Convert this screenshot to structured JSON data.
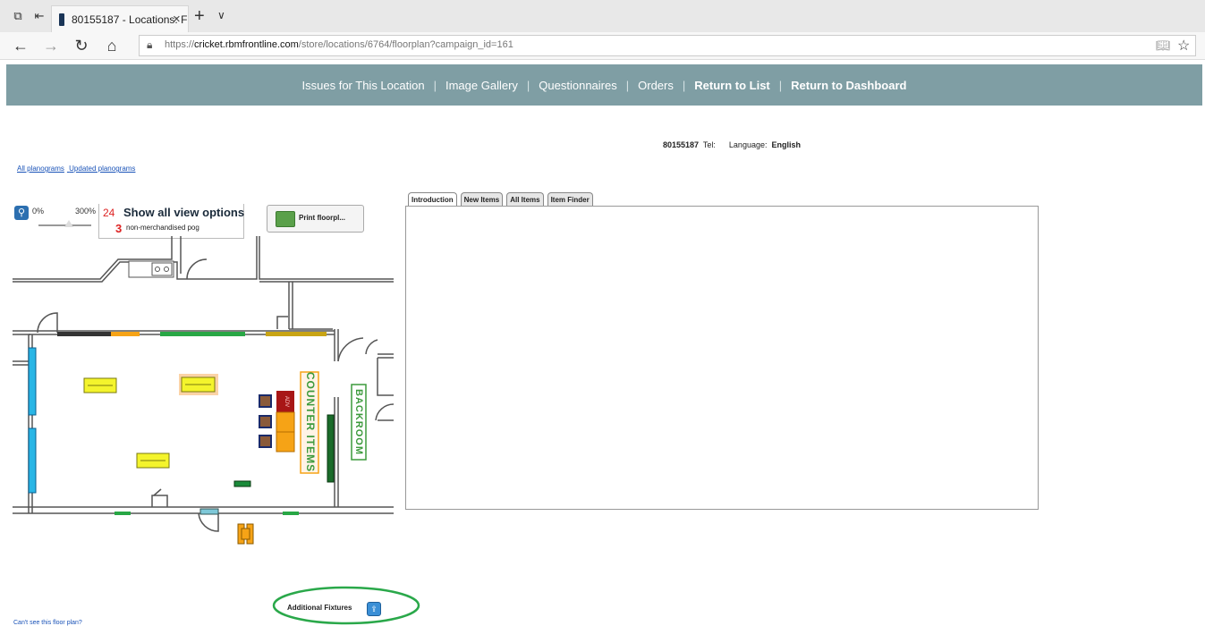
{
  "browser": {
    "tab_title": "80155187 - Locations: F",
    "tab_close": "×",
    "new_tab": "+",
    "tab_menu": "∨",
    "url_domain": "cricket.rbmfrontline.com",
    "url_prefix": "https://",
    "url_path": "/store/locations/6764/floorplan?campaign_id=161",
    "icons": [
      "back-arrow-icon",
      "forward-arrow-icon",
      "refresh-icon",
      "home-icon",
      "lock-icon",
      "reading-view-icon",
      "favorite-star-icon"
    ]
  },
  "sitenav": {
    "items": [
      "Issues for This Location",
      "Image Gallery",
      "Questionnaires",
      "Orders",
      "Return to List",
      "Return to Dashboard"
    ],
    "separator": "|"
  },
  "store": {
    "id": "80155187",
    "tel_label": "Tel:",
    "language_label": "Language:",
    "language": "English"
  },
  "plan_links": [
    "All planograms",
    "Updated planograms"
  ],
  "zoom": {
    "min": "0%",
    "max": "300%"
  },
  "options": {
    "count": "24",
    "label": "Show all view options",
    "nonmerch_count": "3",
    "nonmerch_label": "non-merchandised pog"
  },
  "print_button": "Print floorpl...",
  "floorplan": {
    "counter_label": "COUNTER ITEMS",
    "backroom_label": "BACKROOM",
    "adv_label": "ADV"
  },
  "tabs": [
    "Introduction",
    "New Items",
    "All Items",
    "Item Finder"
  ],
  "active_tab": "Introduction",
  "bottom": {
    "additional_fixtures": "Additional Fixtures",
    "cant_see": "Can't see this floor plan?"
  },
  "colors": {
    "nav_bg": "#7f9ea4",
    "wall": "#555555",
    "fixture_yellow": "#f4f42c",
    "fixture_orange": "#f6a316",
    "fixture_blue": "#29b6e6",
    "fixture_green": "#28a745",
    "counter_text": "#3c9a3c",
    "highlight": "#2aa84a"
  }
}
